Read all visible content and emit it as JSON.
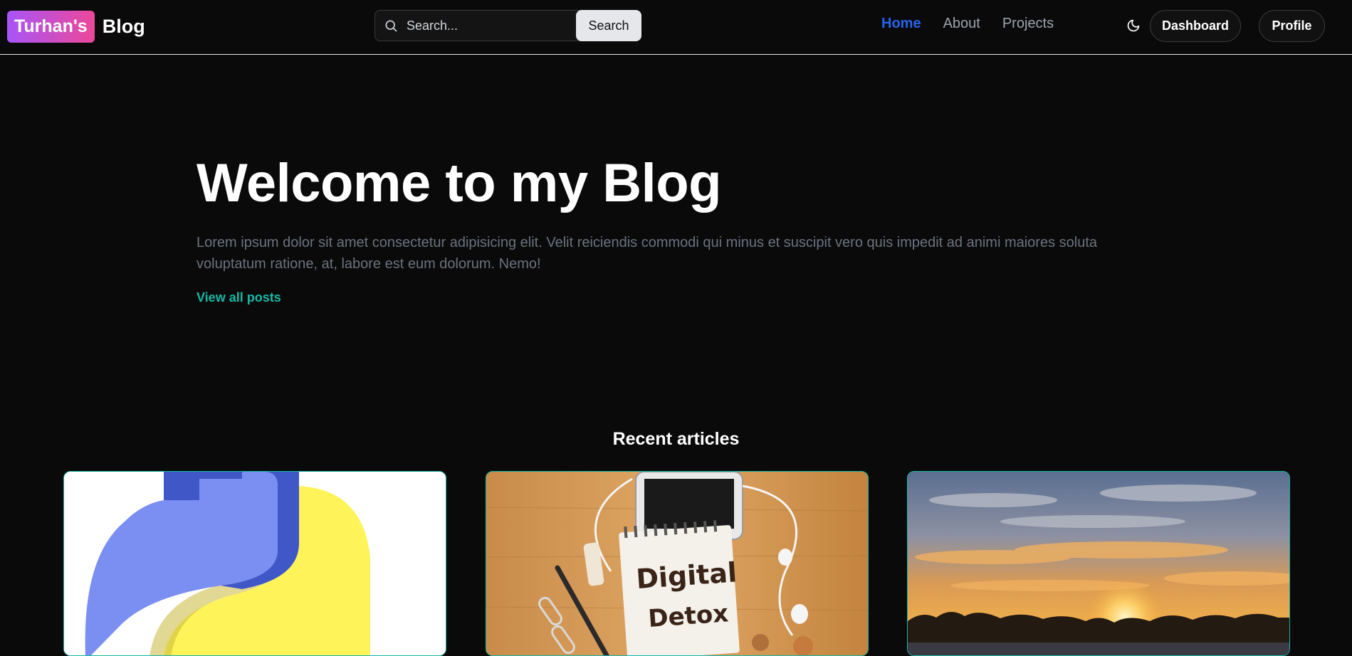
{
  "brand": {
    "badge": "Turhan's",
    "name": "Blog"
  },
  "search": {
    "placeholder": "Search...",
    "button_label": "Search"
  },
  "nav": {
    "items": [
      {
        "label": "Home",
        "active": true
      },
      {
        "label": "About",
        "active": false
      },
      {
        "label": "Projects",
        "active": false
      }
    ]
  },
  "header_actions": {
    "theme_icon": "moon-icon",
    "dashboard_label": "Dashboard",
    "profile_label": "Profile"
  },
  "hero": {
    "title": "Welcome to my Blog",
    "text": "Lorem ipsum dolor sit amet consectetur adipisicing elit. Velit reiciendis commodi qui minus et suscipit vero quis impedit ad animi maiores soluta voluptatum ratione, at, labore est eum dolorum. Nemo!",
    "link_label": "View all posts"
  },
  "recent": {
    "title": "Recent articles",
    "cards": [
      {
        "image": "python-logo-image"
      },
      {
        "image": "digital-detox-notepad-image",
        "image_text_1": "Digital",
        "image_text_2": "Detox"
      },
      {
        "image": "sunset-landscape-image"
      }
    ]
  },
  "colors": {
    "background": "#0a0a0a",
    "accent_nav": "#2563eb",
    "accent_link": "#14b8a6",
    "brand_gradient_start": "#a855f7",
    "brand_gradient_end": "#ec4899"
  }
}
